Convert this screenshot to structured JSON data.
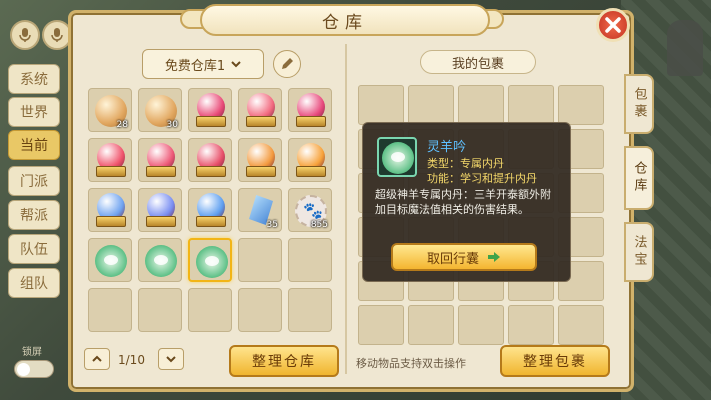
{
  "window": {
    "title": "仓库"
  },
  "chat_channels": [
    "系统",
    "世界",
    "当前",
    "门派",
    "帮派",
    "队伍",
    "组队"
  ],
  "active_channel": "当前",
  "lock_screen": {
    "label": "锁屏"
  },
  "warehouse": {
    "selector_label": "免费仓库1",
    "page": "1/10",
    "sort_button": "整理仓库",
    "slots": [
      {
        "kind": "pearl",
        "count": "28"
      },
      {
        "kind": "pearl",
        "count": "30"
      },
      {
        "kind": "orb-base",
        "color": "#e94b78"
      },
      {
        "kind": "orb-base",
        "color": "#f26a7f"
      },
      {
        "kind": "orb-base",
        "color": "#e84a7d"
      },
      {
        "kind": "orb-base",
        "color": "#f0546c"
      },
      {
        "kind": "orb-base",
        "color": "#ee5a78"
      },
      {
        "kind": "orb-base",
        "color": "#e8506a"
      },
      {
        "kind": "orb-base",
        "color": "#f39a3e"
      },
      {
        "kind": "orb-base",
        "color": "#f7a23a"
      },
      {
        "kind": "orb-base",
        "color": "#6fa3f0"
      },
      {
        "kind": "orb-base",
        "color": "#7a8ff2"
      },
      {
        "kind": "orb-base",
        "color": "#5e9ff0"
      },
      {
        "kind": "crystal",
        "count": "35"
      },
      {
        "kind": "paw",
        "count": "855"
      },
      {
        "kind": "pill"
      },
      {
        "kind": "pill"
      },
      {
        "kind": "pill",
        "selected": true
      },
      {
        "kind": "empty"
      },
      {
        "kind": "empty"
      },
      {
        "kind": "empty"
      },
      {
        "kind": "empty"
      },
      {
        "kind": "empty"
      },
      {
        "kind": "empty"
      },
      {
        "kind": "empty"
      }
    ]
  },
  "bag": {
    "title": "我的包裹",
    "hint": "移动物品支持双击操作",
    "sort_button": "整理包裹",
    "tabs": [
      "包裹",
      "仓库",
      "法宝"
    ],
    "active_tab": "仓库"
  },
  "tooltip": {
    "name": "灵羊吟",
    "type_line": "类型：专属内丹",
    "function_line": "功能：学习和提升内丹",
    "description": "超级神羊专属内丹：三羊开泰额外附加目标魔法值相关的伤害结果。",
    "action_button": "取回行囊"
  },
  "colors": {
    "accent_gold": "#f0b52f",
    "tooltip_name": "#5fc0ff",
    "tooltip_meta": "#f4d86a",
    "close": "#c43322"
  }
}
